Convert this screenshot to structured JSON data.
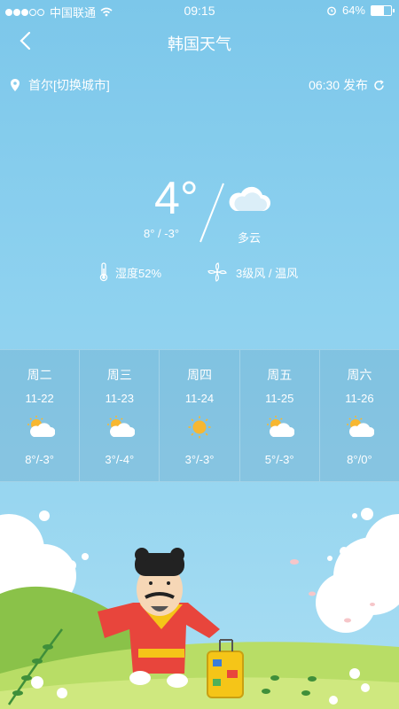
{
  "status": {
    "carrier": "中国联通",
    "time": "09:15",
    "battery": "64%",
    "battery_level": 0.64,
    "signal_filled": 3,
    "signal_total": 5
  },
  "nav": {
    "title": "韩国天气",
    "back_icon": "chevron-left-icon"
  },
  "location": {
    "city": "首尔[切换城市]",
    "published": "06:30 发布",
    "icon": "location-pin-icon",
    "refresh_icon": "refresh-icon"
  },
  "current": {
    "temp": "4°",
    "range": "8° / -3°",
    "condition": "多云",
    "condition_icon": "cloud-icon",
    "humidity": "湿度52%",
    "humidity_icon": "thermometer-icon",
    "wind": "3级风 / 温风",
    "wind_icon": "fan-icon"
  },
  "forecast": [
    {
      "weekday": "周二",
      "date": "11-22",
      "icon": "partly-cloudy-icon",
      "temps": "8°/-3°"
    },
    {
      "weekday": "周三",
      "date": "11-23",
      "icon": "partly-cloudy-icon",
      "temps": "3°/-4°"
    },
    {
      "weekday": "周四",
      "date": "11-24",
      "icon": "sun-icon",
      "temps": "3°/-3°"
    },
    {
      "weekday": "周五",
      "date": "11-25",
      "icon": "partly-cloudy-icon",
      "temps": "5°/-3°"
    },
    {
      "weekday": "周六",
      "date": "11-26",
      "icon": "partly-cloudy-icon",
      "temps": "8°/0°"
    }
  ],
  "colors": {
    "sky_top": "#7cc7ea",
    "sky_bottom": "#a9def3",
    "sun": "#f7b731",
    "hill": "#8ac249",
    "robe": "#e8453c"
  }
}
